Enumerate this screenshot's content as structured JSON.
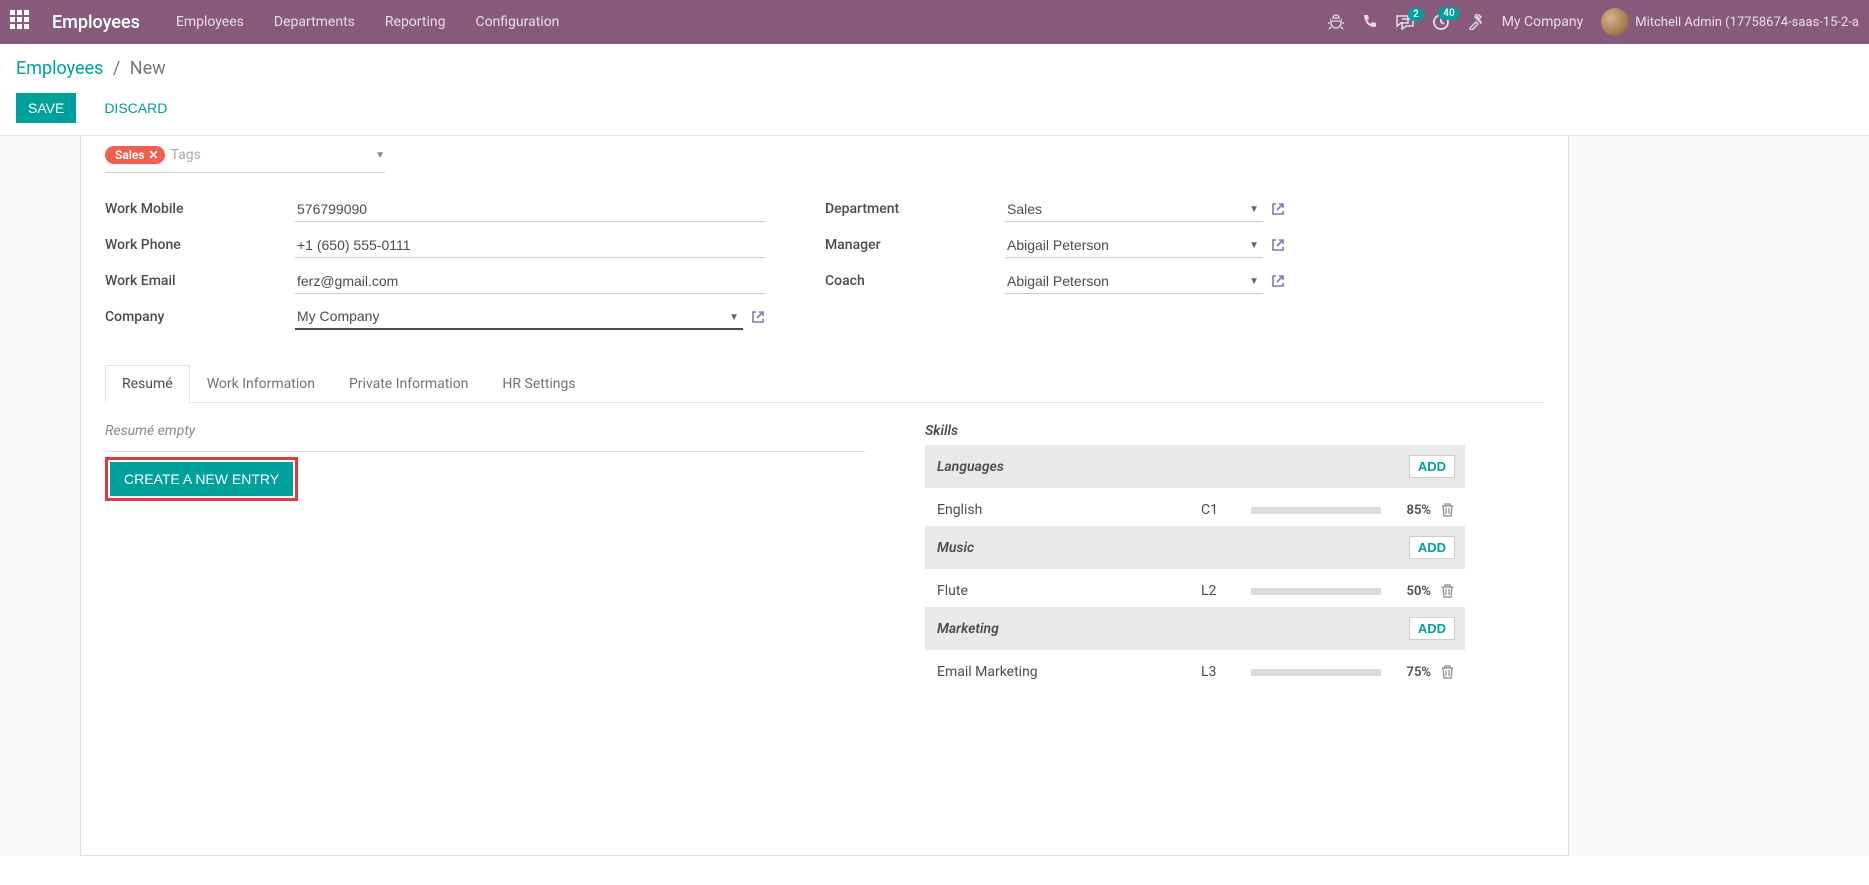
{
  "topbar": {
    "brand": "Employees",
    "nav": [
      "Employees",
      "Departments",
      "Reporting",
      "Configuration"
    ],
    "badges": {
      "messages": "2",
      "activities": "40"
    },
    "company": "My Company",
    "user": "Mitchell Admin (17758674-saas-15-2-a"
  },
  "breadcrumb": {
    "root": "Employees",
    "current": "New"
  },
  "buttons": {
    "save": "Save",
    "discard": "Discard"
  },
  "tags": {
    "chip": "Sales",
    "placeholder": "Tags"
  },
  "fields_left": {
    "work_mobile_label": "Work Mobile",
    "work_mobile": "576799090",
    "work_phone_label": "Work Phone",
    "work_phone": "+1 (650) 555-0111",
    "work_email_label": "Work Email",
    "work_email": "ferz@gmail.com",
    "company_label": "Company",
    "company": "My Company"
  },
  "fields_right": {
    "department_label": "Department",
    "department": "Sales",
    "manager_label": "Manager",
    "manager": "Abigail Peterson",
    "coach_label": "Coach",
    "coach": "Abigail Peterson"
  },
  "tabs": [
    "Resumé",
    "Work Information",
    "Private Information",
    "HR Settings"
  ],
  "resume": {
    "empty": "Resumé empty",
    "create": "CREATE A NEW ENTRY"
  },
  "skills": {
    "heading": "Skills",
    "add": "ADD",
    "groups": [
      {
        "type": "Languages",
        "items": [
          {
            "name": "English",
            "level": "C1",
            "pct": "85%",
            "fill": 85
          }
        ]
      },
      {
        "type": "Music",
        "items": [
          {
            "name": "Flute",
            "level": "L2",
            "pct": "50%",
            "fill": 50
          }
        ]
      },
      {
        "type": "Marketing",
        "items": [
          {
            "name": "Email Marketing",
            "level": "L3",
            "pct": "75%",
            "fill": 75
          }
        ]
      }
    ]
  }
}
